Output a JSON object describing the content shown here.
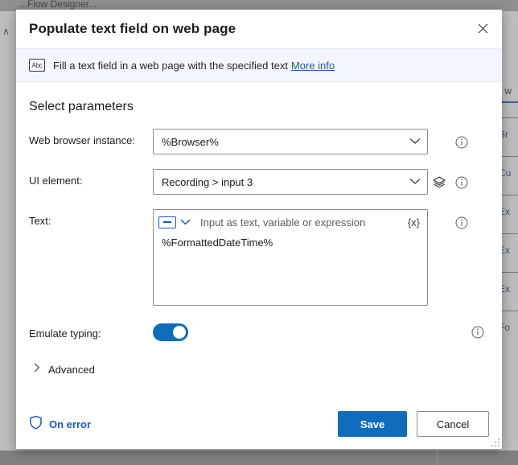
{
  "background": {
    "top_title": "...Flow Designer...",
    "right_panel": {
      "header": "v w",
      "items": [
        "Br",
        "Cu",
        "Ex",
        "Ex",
        "Ex",
        "Fo"
      ]
    }
  },
  "dialog": {
    "title": "Populate text field on web page",
    "close_icon": "close-icon",
    "banner": {
      "icon_label": "Abc",
      "text": "Fill a text field in a web page with the specified text",
      "link": "More info"
    },
    "section_title": "Select parameters",
    "fields": {
      "browser_instance": {
        "label": "Web browser instance:",
        "value": "%Browser%",
        "info_icon": "info-icon"
      },
      "ui_element": {
        "label": "UI element:",
        "value": "Recording > input 3",
        "picker_icon": "layers-icon",
        "info_icon": "info-icon"
      },
      "text": {
        "label": "Text:",
        "mode_icon": "text-input-mode-icon",
        "placeholder": "Input as text, variable or expression",
        "expression_button": "{x}",
        "value": "%FormattedDateTime%",
        "info_icon": "info-icon"
      },
      "emulate_typing": {
        "label": "Emulate typing:",
        "state": "on",
        "info_icon": "info-icon"
      }
    },
    "advanced": {
      "label": "Advanced",
      "expanded": false
    },
    "footer": {
      "on_error_label": "On error",
      "on_error_icon": "shield-icon",
      "save_label": "Save",
      "cancel_label": "Cancel"
    }
  },
  "colors": {
    "accent": "#0f6cbd",
    "link": "#1a57c4",
    "banner_bg": "#f3f6fc",
    "border": "#8a8a8a"
  }
}
